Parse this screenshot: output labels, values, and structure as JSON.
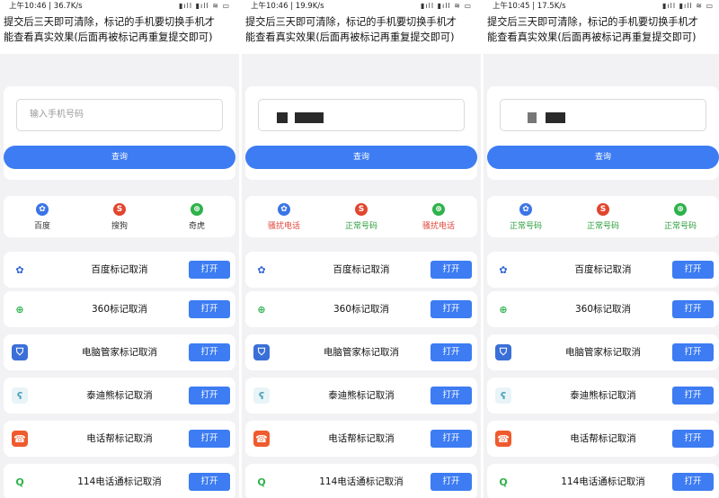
{
  "panels": [
    {
      "status": {
        "time": "上午10:46",
        "speed": "36.7K/s",
        "right": "▮ıll ▮ıll ≋ ▭"
      },
      "notice": [
        "提交后三天即可清除，标记的手机要切换手机才",
        "能查看真实效果(后面再被标记再重复提交即可)"
      ],
      "input_placeholder": "输入手机号码",
      "input_value": "",
      "query_label": "查询",
      "results": [
        {
          "label": "百度",
          "color": "#333333",
          "icon_bg": "#3b74e6",
          "icon": "baidu-paw-icon"
        },
        {
          "label": "搜狗",
          "color": "#333333",
          "icon_bg": "#e2462f",
          "icon": "sogou-s-icon"
        },
        {
          "label": "奇虎",
          "color": "#333333",
          "icon_bg": "#2fb24c",
          "icon": "qihoo-360-icon"
        }
      ],
      "rows": [
        {
          "label": "百度标记取消",
          "button": "打开",
          "icon": "baidu-paw-icon"
        },
        {
          "label": "360标记取消",
          "button": "打开",
          "icon": "360-icon"
        },
        {
          "label": "电脑管家标记取消",
          "button": "打开",
          "icon": "shield-icon"
        },
        {
          "label": "泰迪熊标记取消",
          "button": "打开",
          "icon": "teddy-bear-icon"
        },
        {
          "label": "电话帮标记取消",
          "button": "打开",
          "icon": "phone-helper-icon"
        },
        {
          "label": "114电话通标记取消",
          "button": "打开",
          "icon": "114-search-icon"
        }
      ]
    },
    {
      "status": {
        "time": "上午10:46",
        "speed": "19.9K/s",
        "right": "▮ıll ▮ıll ≋ ▭"
      },
      "notice": [
        "提交后三天即可清除，标记的手机要切换手机才",
        "能查看真实效果(后面再被标记再重复提交即可)"
      ],
      "input_placeholder": "",
      "input_value": "",
      "query_label": "查询",
      "results": [
        {
          "label": "骚扰电话",
          "color": "#e0453a",
          "icon_bg": "#3b74e6",
          "icon": "baidu-paw-icon"
        },
        {
          "label": "正常号码",
          "color": "#2e9e3e",
          "icon_bg": "#e2462f",
          "icon": "sogou-s-icon"
        },
        {
          "label": "骚扰电话",
          "color": "#e0453a",
          "icon_bg": "#2fb24c",
          "icon": "qihoo-360-icon"
        }
      ],
      "rows": [
        {
          "label": "百度标记取消",
          "button": "打开",
          "icon": "baidu-paw-icon"
        },
        {
          "label": "360标记取消",
          "button": "打开",
          "icon": "360-icon"
        },
        {
          "label": "电脑管家标记取消",
          "button": "打开",
          "icon": "shield-icon"
        },
        {
          "label": "泰迪熊标记取消",
          "button": "打开",
          "icon": "teddy-bear-icon"
        },
        {
          "label": "电话帮标记取消",
          "button": "打开",
          "icon": "phone-helper-icon"
        },
        {
          "label": "114电话通标记取消",
          "button": "打开",
          "icon": "114-search-icon"
        }
      ]
    },
    {
      "status": {
        "time": "上午10:45",
        "speed": "17.5K/s",
        "right": "▮ıll ▮ıll ≋ ▭"
      },
      "notice": [
        "提交后三天即可清除，标记的手机要切换手机才",
        "能查看真实效果(后面再被标记再重复提交即可)"
      ],
      "input_placeholder": "",
      "input_value": "",
      "query_label": "查询",
      "results": [
        {
          "label": "正常号码",
          "color": "#2e9e3e",
          "icon_bg": "#3b74e6",
          "icon": "baidu-paw-icon"
        },
        {
          "label": "正常号码",
          "color": "#2e9e3e",
          "icon_bg": "#e2462f",
          "icon": "sogou-s-icon"
        },
        {
          "label": "正常号码",
          "color": "#2e9e3e",
          "icon_bg": "#2fb24c",
          "icon": "qihoo-360-icon"
        }
      ],
      "rows": [
        {
          "label": "百度标记取消",
          "button": "打开",
          "icon": "baidu-paw-icon"
        },
        {
          "label": "360标记取消",
          "button": "打开",
          "icon": "360-icon"
        },
        {
          "label": "电脑管家标记取消",
          "button": "打开",
          "icon": "shield-icon"
        },
        {
          "label": "泰迪熊标记取消",
          "button": "打开",
          "icon": "teddy-bear-icon"
        },
        {
          "label": "电话帮标记取消",
          "button": "打开",
          "icon": "phone-helper-icon"
        },
        {
          "label": "114电话通标记取消",
          "button": "打开",
          "icon": "114-search-icon"
        }
      ]
    }
  ],
  "colors": {
    "accent": "#3d7cf2",
    "page_bg": "#f2f2f4"
  }
}
